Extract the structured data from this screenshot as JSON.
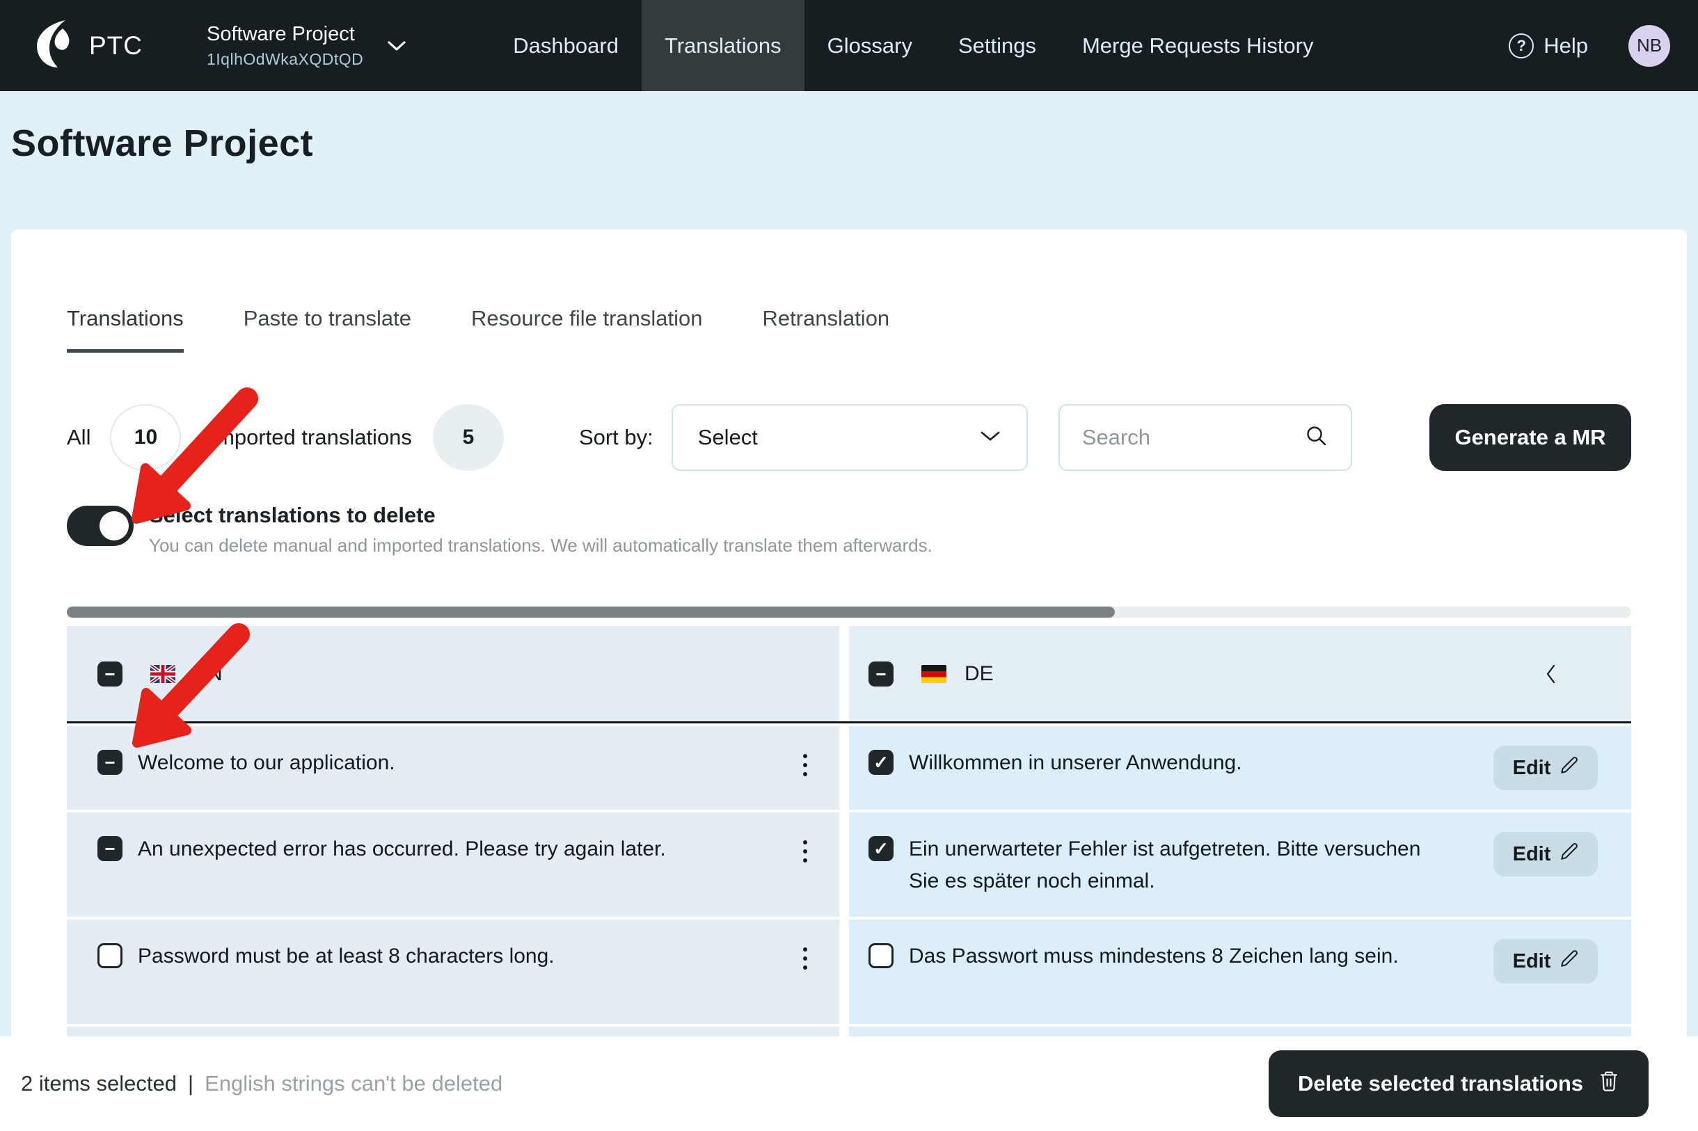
{
  "brand": {
    "name": "PTC"
  },
  "project_selector": {
    "name": "Software Project",
    "id": "1IqlhOdWkaXQDtQD"
  },
  "nav": {
    "items": [
      {
        "label": "Dashboard"
      },
      {
        "label": "Translations"
      },
      {
        "label": "Glossary"
      },
      {
        "label": "Settings"
      },
      {
        "label": "Merge Requests History"
      }
    ]
  },
  "help": {
    "label": "Help",
    "icon_glyph": "?"
  },
  "avatar": {
    "initials": "NB"
  },
  "page": {
    "title": "Software Project"
  },
  "tabs": [
    {
      "label": "Translations"
    },
    {
      "label": "Paste to translate"
    },
    {
      "label": "Resource file translation"
    },
    {
      "label": "Retranslation"
    }
  ],
  "filters": {
    "all_label": "All",
    "all_count": "10",
    "imported_label": "Imported translations",
    "imported_count": "5",
    "sort_label": "Sort by:",
    "sort_value": "Select",
    "search_placeholder": "Search",
    "generate_button": "Generate a MR"
  },
  "toggle": {
    "label": "Select translations to delete",
    "description": "You can delete manual and imported translations. We will automatically translate them afterwards."
  },
  "table": {
    "source_lang": "EN",
    "target_lang": "DE",
    "header_glyph": "−",
    "edit_label": "Edit",
    "rows": [
      {
        "en": "Welcome to our application.",
        "de": "Willkommen in unserer Anwendung.",
        "en_glyph": "−",
        "de_glyph": "✓"
      },
      {
        "en": "An unexpected error has occurred. Please try again later.",
        "de": "Ein unerwarteter Fehler ist aufgetreten. Bitte versuchen Sie es später noch einmal.",
        "en_glyph": "−",
        "de_glyph": "✓"
      },
      {
        "en": "Password must be at least 8 characters long.",
        "de": "Das Passwort muss mindestens 8 Zeichen lang sein.",
        "en_glyph": "",
        "de_glyph": ""
      }
    ]
  },
  "footer": {
    "selected_text": "2 items selected",
    "separator": "|",
    "note": "English strings can't be deleted",
    "delete_button": "Delete selected translations"
  },
  "colors": {
    "navbar_bg": "#171e21",
    "page_bg": "#e2f1f8",
    "brand_dark": "#20272a",
    "en_cell": "#e4edf3",
    "de_cell": "#dbeefa",
    "annotation_red": "#e5231b",
    "avatar_bg": "#d9d1ee"
  }
}
